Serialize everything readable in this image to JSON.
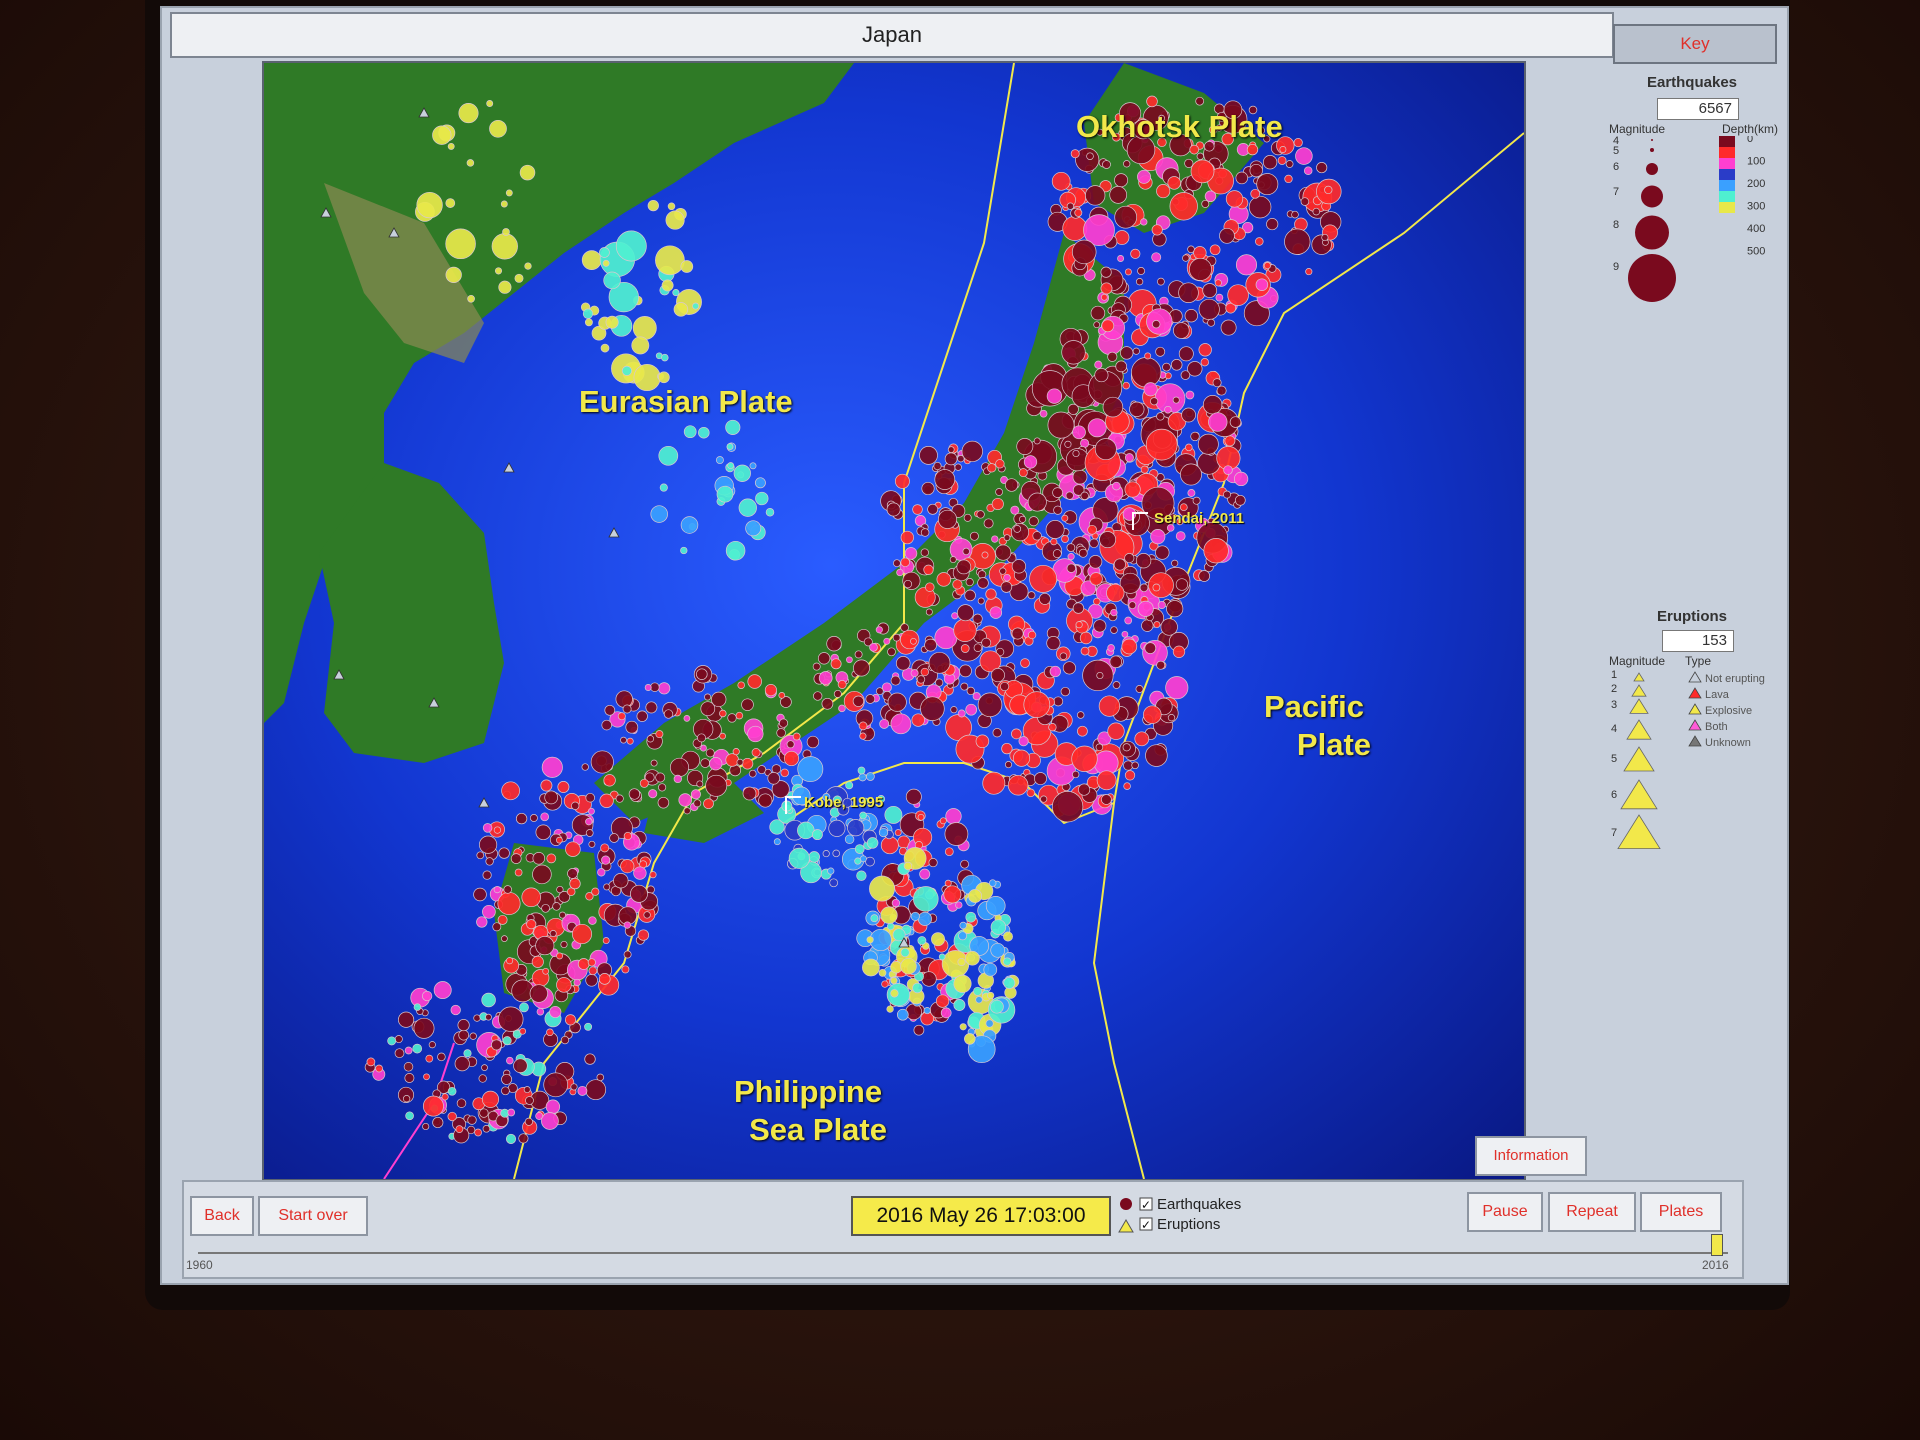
{
  "window": {
    "title": "Japan"
  },
  "map": {
    "plates": {
      "okhotsk": "Okhotsk Plate",
      "eurasian": "Eurasian Plate",
      "pacific_line1": "Pacific",
      "pacific_line2": "Plate",
      "philippine_line1": "Philippine",
      "philippine_line2": "Sea Plate"
    },
    "cities": {
      "sendai": "Sendai, 2011",
      "kobe": "Kobe, 1995"
    },
    "colors": {
      "ocean": "#0a24b0",
      "land": "#2f7a26",
      "plate_boundary": "#f2e84a",
      "label": "#f2e84a"
    }
  },
  "information_button": "Information",
  "key": {
    "button": "Key",
    "earthquakes": {
      "title": "Earthquakes",
      "count": "6567",
      "magnitude_label": "Magnitude",
      "depth_label": "Depth(km)",
      "magnitudes": [
        "4",
        "5",
        "6",
        "7",
        "8",
        "9"
      ],
      "depths": [
        "0",
        "100",
        "200",
        "300",
        "400",
        "500"
      ],
      "depth_colors": [
        "#7a0a1e",
        "#ff2a2a",
        "#ff3fd0",
        "#2a3cc8",
        "#3aa0ff",
        "#4ff0d0",
        "#e8e84a"
      ]
    },
    "eruptions": {
      "title": "Eruptions",
      "count": "153",
      "magnitude_label": "Magnitude",
      "type_label": "Type",
      "magnitudes": [
        "1",
        "2",
        "3",
        "4",
        "5",
        "6",
        "7"
      ],
      "types": [
        {
          "label": "Not erupting",
          "color": "#c8d0dc"
        },
        {
          "label": "Lava",
          "color": "#ff2a2a"
        },
        {
          "label": "Explosive",
          "color": "#f2e84a"
        },
        {
          "label": "Both",
          "color": "#ff5ad8"
        },
        {
          "label": "Unknown",
          "color": "#777777"
        }
      ]
    }
  },
  "bottom": {
    "back": "Back",
    "start_over": "Start over",
    "datetime": "2016 May 26 17:03:00",
    "earthquakes_toggle": "Earthquakes",
    "eruptions_toggle": "Eruptions",
    "pause": "Pause",
    "repeat": "Repeat",
    "plates": "Plates",
    "year_start": "1960",
    "year_end": "2016"
  }
}
